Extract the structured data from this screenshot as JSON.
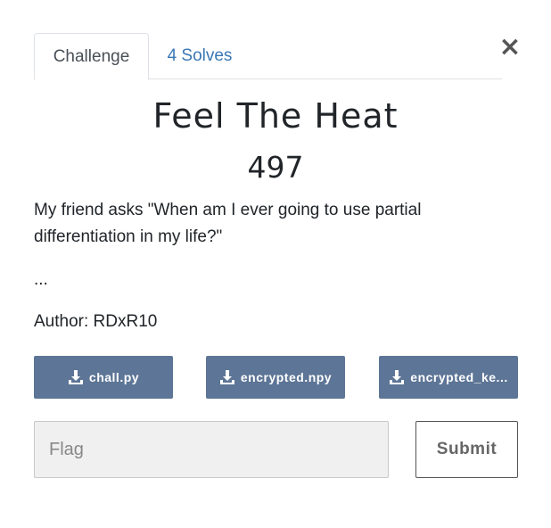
{
  "tabs": {
    "challenge": "Challenge",
    "solves": "4 Solves"
  },
  "close_label": "×",
  "challenge": {
    "name": "Feel The Heat",
    "points": "497",
    "description": "My friend asks \"When am I ever going to use partial differentiation in my life?\"",
    "ellipsis": "...",
    "author": "Author: RDxR10"
  },
  "files": [
    {
      "label": "chall.py",
      "icon": "download-icon"
    },
    {
      "label": "encrypted.npy",
      "icon": "download-icon"
    },
    {
      "label": "encrypted_ke...",
      "icon": "download-icon"
    }
  ],
  "flag_form": {
    "placeholder": "Flag",
    "submit_label": "Submit"
  },
  "colors": {
    "file_button_bg": "#5d7596",
    "tab_link": "#3a77b5",
    "input_bg": "#f0f0f0"
  }
}
